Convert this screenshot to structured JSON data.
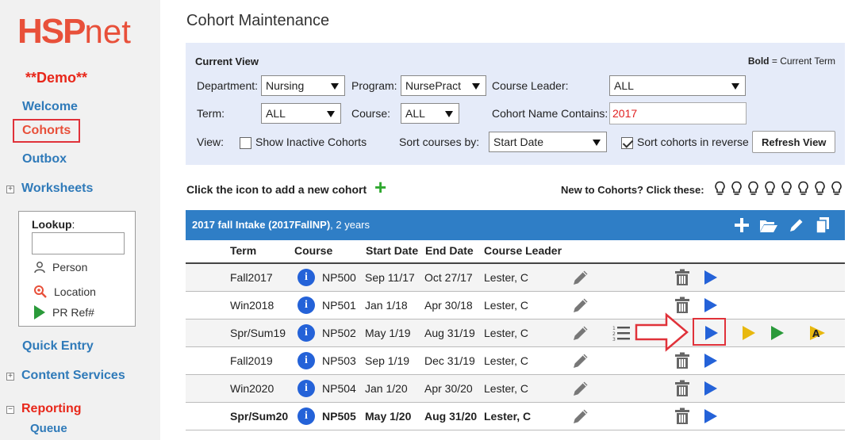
{
  "sidebar": {
    "logo_main": "HSP",
    "logo_sub": "net",
    "demo": "**Demo**",
    "welcome": "Welcome",
    "cohorts": "Cohorts",
    "outbox": "Outbox",
    "worksheets": "Worksheets",
    "lookup_title": "Lookup",
    "lookup_colon": ":",
    "lookup_person": "Person",
    "lookup_location": "Location",
    "lookup_prref": "PR Ref#",
    "quick_entry": "Quick Entry",
    "content_services": "Content Services",
    "reporting": "Reporting",
    "queue": "Queue",
    "expand_plus": "+",
    "expand_minus": "−"
  },
  "page_title": "Cohort Maintenance",
  "current_view": {
    "title": "Current View",
    "legend_bold": "Bold",
    "legend_rest": " = Current Term",
    "department_label": "Department:",
    "department_value": "Nursing",
    "program_label": "Program:",
    "program_value": "NursePract",
    "course_leader_label": "Course Leader:",
    "course_leader_value": "ALL",
    "term_label": "Term:",
    "term_value": "ALL",
    "course_label": "Course:",
    "course_value": "ALL",
    "cohort_name_label": "Cohort Name Contains:",
    "cohort_name_value": "2017",
    "view_label": "View:",
    "show_inactive_label": "Show Inactive Cohorts",
    "show_inactive_checked": false,
    "sort_by_label": "Sort courses by:",
    "sort_by_value": "Start Date",
    "sort_reverse_label": "Sort cohorts in reverse",
    "sort_reverse_checked": true,
    "refresh_button": "Refresh View"
  },
  "add_cohort_label": "Click the icon to add a new cohort",
  "new_to_cohorts_label": "New to Cohorts? Click these:",
  "bulb_count": 8,
  "cohort": {
    "name": "2017 fall Intake (2017FallNP)",
    "duration": ", 2 years"
  },
  "table": {
    "headers": [
      "Term",
      "Course",
      "Start Date",
      "End Date",
      "Course Leader"
    ],
    "info_glyph": "i",
    "rows": [
      {
        "term": "Fall2017",
        "course": "NP500",
        "start": "Sep 11/17",
        "end": "Oct 27/17",
        "leader": "Lester, C",
        "current": false
      },
      {
        "term": "Win2018",
        "course": "NP501",
        "start": "Jan 1/18",
        "end": "Apr 30/18",
        "leader": "Lester, C",
        "current": false
      },
      {
        "term": "Spr/Sum19",
        "course": "NP502",
        "start": "May 1/19",
        "end": "Aug 31/19",
        "leader": "Lester, C",
        "current": false
      },
      {
        "term": "Fall2019",
        "course": "NP503",
        "start": "Sep 1/19",
        "end": "Dec 31/19",
        "leader": "Lester, C",
        "current": false
      },
      {
        "term": "Win2020",
        "course": "NP504",
        "start": "Jan 1/20",
        "end": "Apr 30/20",
        "leader": "Lester, C",
        "current": false
      },
      {
        "term": "Spr/Sum20",
        "course": "NP505",
        "start": "May 1/20",
        "end": "Aug 31/20",
        "leader": "Lester, C",
        "current": true
      }
    ]
  },
  "colors": {
    "accent_blue": "#2f7ec6",
    "link_blue": "#2f7ab9",
    "brand_red": "#e8503a",
    "play_blue": "#2462d8",
    "play_yellow": "#e8b80e",
    "play_green": "#2a9a3a",
    "highlight_red": "#e0323a"
  }
}
